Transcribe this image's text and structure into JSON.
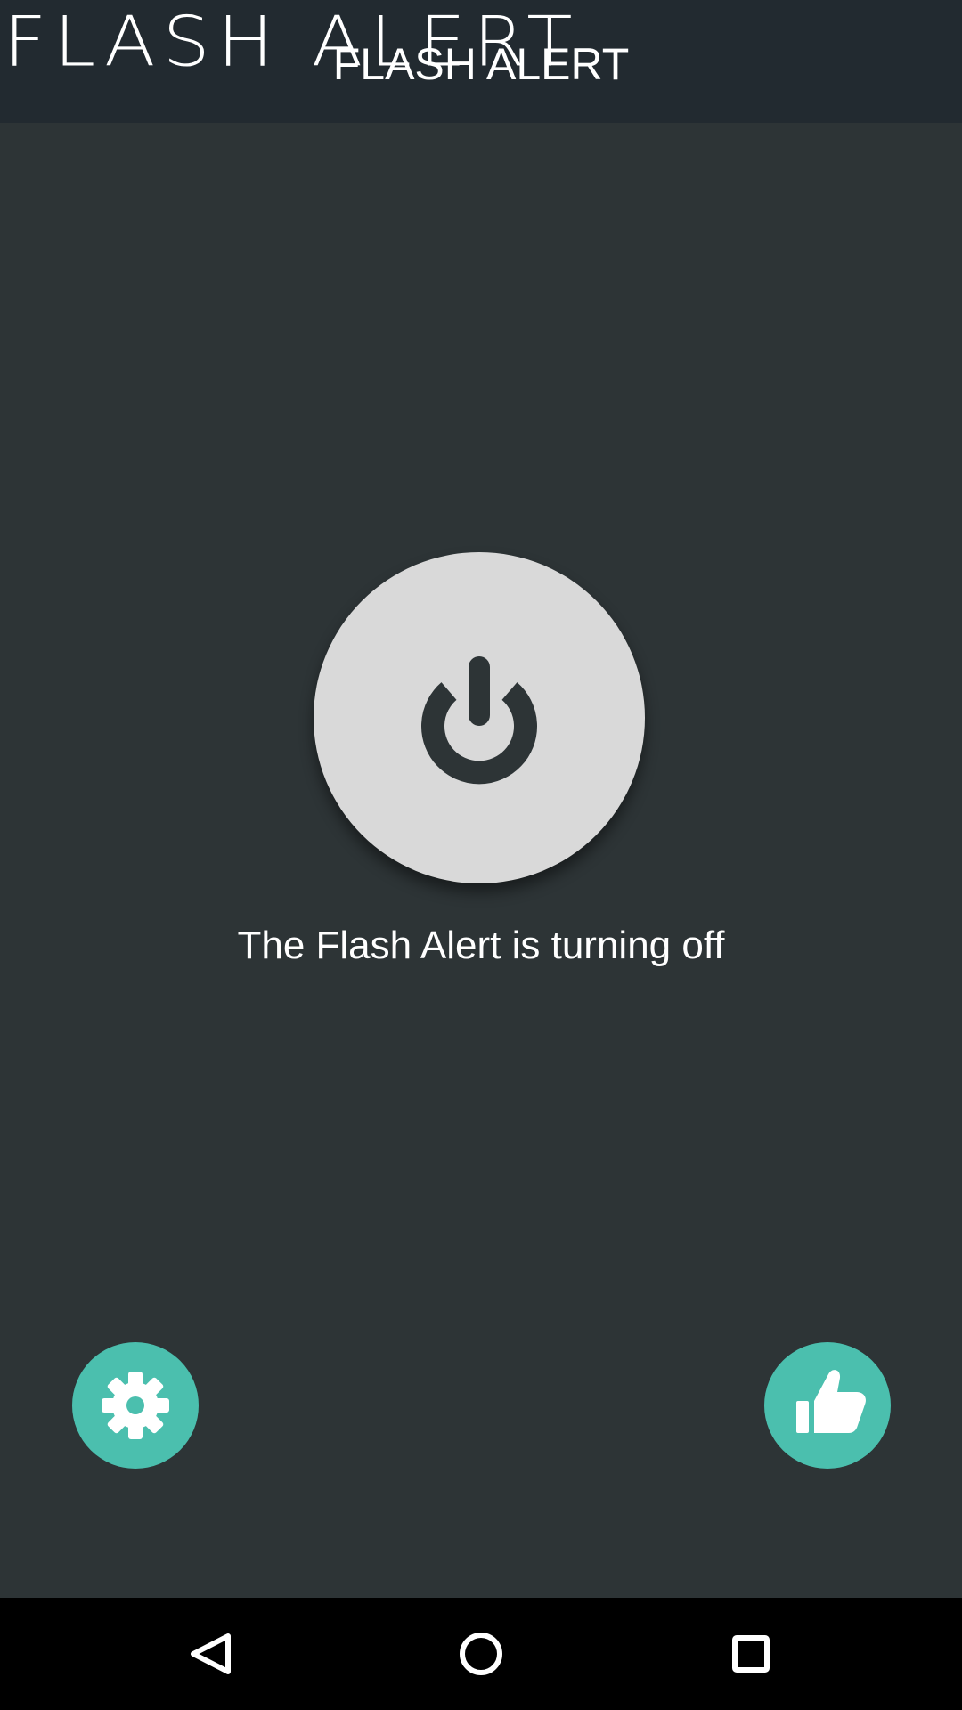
{
  "app": {
    "logo_text": "FLASH ALERT",
    "title": "FLASH ALERT"
  },
  "main": {
    "status_text": "The Flash Alert is turning off",
    "power_state": "off"
  },
  "actions": {
    "settings_icon": "gear-icon",
    "like_icon": "thumbs-up-icon"
  },
  "navigation": {
    "back_icon": "back-triangle-icon",
    "home_icon": "home-circle-icon",
    "recents_icon": "recents-square-icon"
  },
  "colors": {
    "background": "#2d3436",
    "app_bar": "#222a30",
    "accent": "#4bbfae",
    "power_button": "#d9d9d9",
    "power_icon": "#2d3436",
    "nav_bar": "#000000"
  }
}
